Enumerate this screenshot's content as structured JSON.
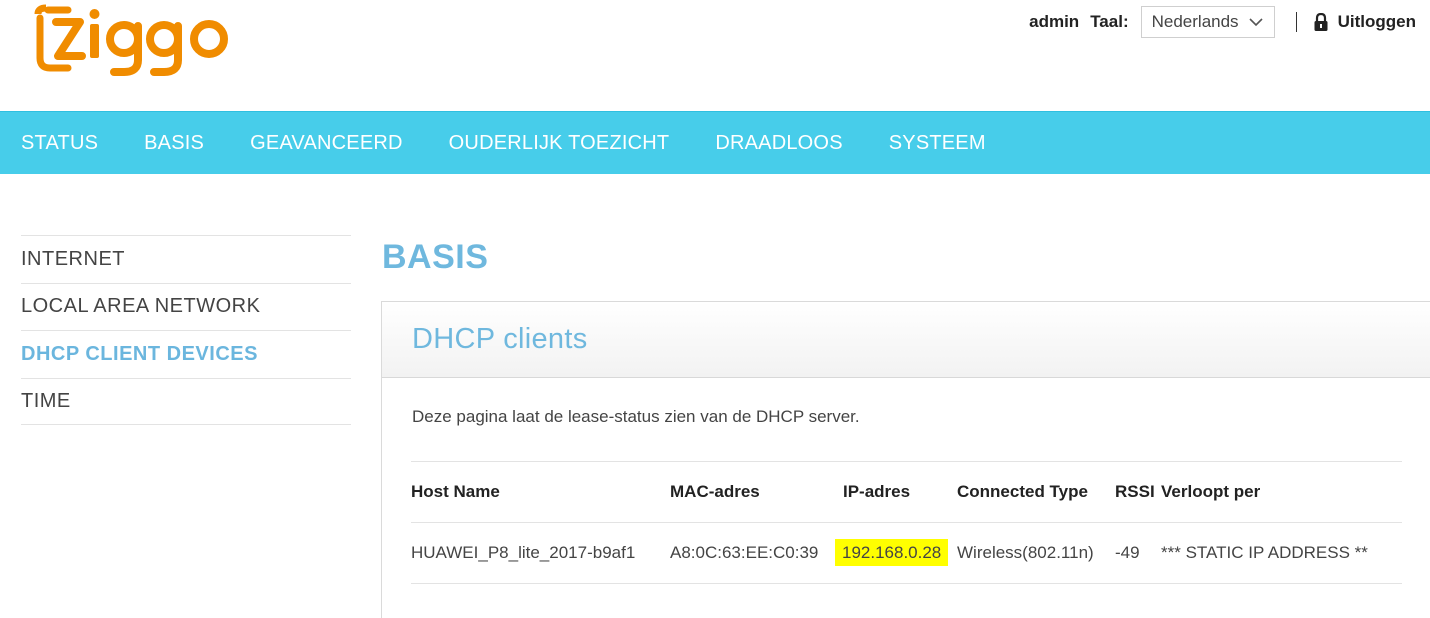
{
  "header": {
    "logo_text": "ziggo",
    "brand_color": "#f08c00",
    "user": "admin",
    "language_label": "Taal:",
    "language_value": "Nederlands",
    "logout_label": "Uitloggen"
  },
  "nav": {
    "color": "#47cdea",
    "items": [
      "STATUS",
      "BASIS",
      "GEAVANCEERD",
      "OUDERLIJK TOEZICHT",
      "DRAADLOOS",
      "SYSTEEM"
    ]
  },
  "sidebar": {
    "items": [
      {
        "label": "INTERNET",
        "active": false
      },
      {
        "label": "LOCAL AREA NETWORK",
        "active": false
      },
      {
        "label": "DHCP CLIENT DEVICES",
        "active": true
      },
      {
        "label": "TIME",
        "active": false
      }
    ]
  },
  "main": {
    "page_title": "BASIS",
    "panel_title": "DHCP clients",
    "description": "Deze pagina laat de lease-status zien van de DHCP server.",
    "table": {
      "headers": [
        "Host Name",
        "MAC-adres",
        "IP-adres",
        "Connected Type",
        "RSSI",
        "Verloopt per"
      ],
      "rows": [
        [
          "HUAWEI_P8_lite_2017-b9af1",
          "A8:0C:63:EE:C0:39",
          "192.168.0.28",
          "Wireless(802.11n)",
          "-49",
          "*** STATIC IP ADDRESS **"
        ]
      ],
      "highlight_color": "#ffff00"
    }
  }
}
